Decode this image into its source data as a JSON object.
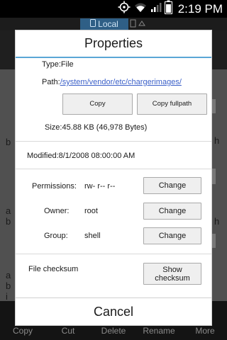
{
  "status_bar": {
    "time": "2:19 PM"
  },
  "background": {
    "tabs": {
      "local": "Local"
    },
    "left_fragments": [
      "b",
      "a",
      "b",
      "a",
      "b",
      "i"
    ],
    "right_fragments": [
      "h",
      "h"
    ],
    "toolbar": [
      "Copy",
      "Cut",
      "Delete",
      "Rename",
      "More"
    ]
  },
  "dialog": {
    "title": "Properties",
    "type": "Type:File",
    "path_label": "Path:",
    "path_value": "/system/vendor/etc/chargerimages/",
    "copy_button": "Copy",
    "copy_fullpath_button": "Copy fullpath",
    "size": "Size:45.88 KB (46,978 Bytes)",
    "modified": "Modified:8/1/2008 08:00:00 AM",
    "permissions_label": "Permissions:",
    "permissions_value": "rw- r-- r--",
    "owner_label": "Owner:",
    "owner_value": "root",
    "group_label": "Group:",
    "group_value": "shell",
    "change_button": "Change",
    "checksum_label": "File checksum",
    "show_checksum_line1": "Show",
    "show_checksum_line2": "checksum",
    "cancel": "Cancel"
  }
}
